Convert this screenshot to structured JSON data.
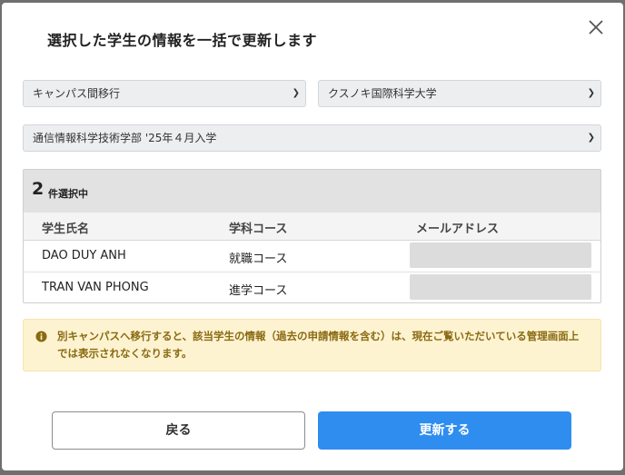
{
  "modal": {
    "title": "選択した学生の情報を一括で更新します",
    "close_icon": "close-icon"
  },
  "form": {
    "action_select": {
      "value": "キャンパス間移行"
    },
    "university_select": {
      "value": "クスノキ国際科学大学"
    },
    "department_select": {
      "value": "通信情報科学技術学部 '25年４月入学"
    }
  },
  "selection": {
    "count": "2",
    "label": "件選択中",
    "columns": [
      "学生氏名",
      "学科コース",
      "メールアドレス"
    ],
    "rows": [
      {
        "name": "DAO DUY ANH",
        "course": "就職コース",
        "email": ""
      },
      {
        "name": "TRAN VAN PHONG",
        "course": "進学コース",
        "email": ""
      }
    ]
  },
  "notice": {
    "icon": "info-icon",
    "text": "別キャンパスへ移行すると、該当学生の情報（過去の申請情報を含む）は、現在ご覧いただいている管理画面上では表示されなくなります。"
  },
  "buttons": {
    "back": "戻る",
    "update": "更新する"
  },
  "colors": {
    "primary": "#2f8df0",
    "notice_bg": "#fdf3d1",
    "notice_text": "#8a6a12",
    "select_bg": "#eceef0"
  }
}
